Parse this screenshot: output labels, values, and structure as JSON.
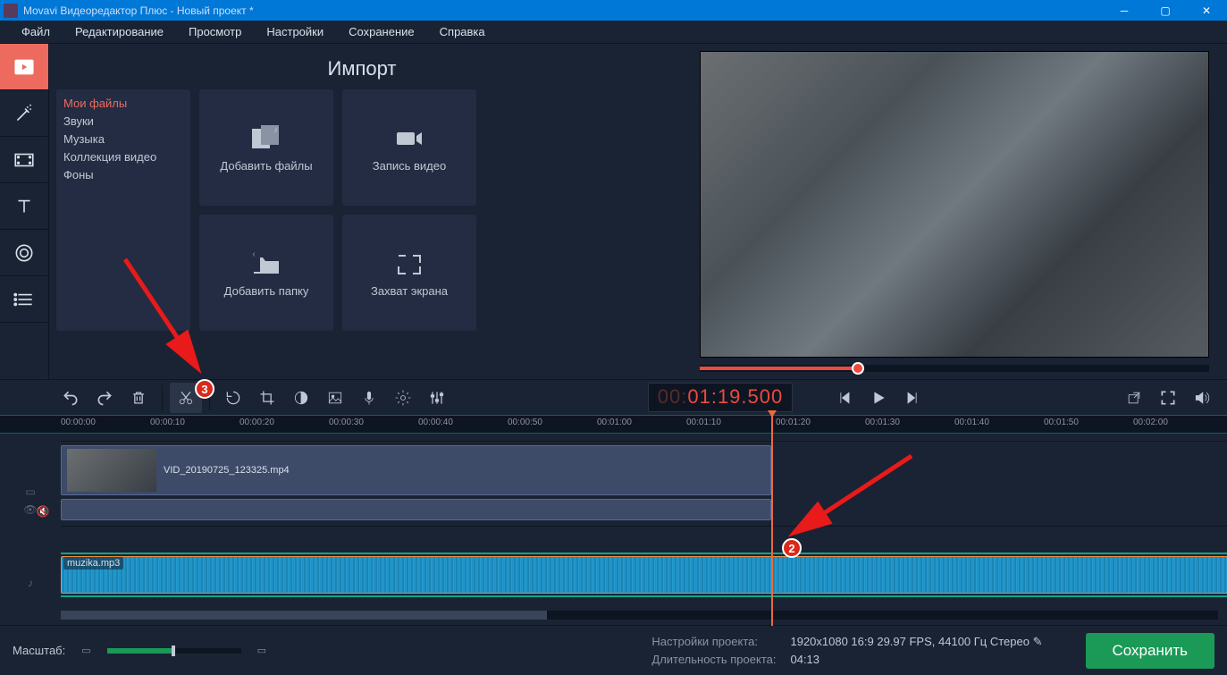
{
  "title": "Movavi Видеоредактор Плюс - Новый проект *",
  "menu": [
    "Файл",
    "Редактирование",
    "Просмотр",
    "Настройки",
    "Сохранение",
    "Справка"
  ],
  "import": {
    "heading": "Импорт",
    "categories": [
      "Мои файлы",
      "Звуки",
      "Музыка",
      "Коллекция видео",
      "Фоны"
    ],
    "active_category": 0,
    "cards": [
      "Добавить файлы",
      "Запись видео",
      "Добавить папку",
      "Захват экрана"
    ]
  },
  "timecode": {
    "dim_prefix": "00:",
    "value": "01:19.500"
  },
  "ruler_ticks": [
    "00:00:00",
    "00:00:10",
    "00:00:20",
    "00:00:30",
    "00:00:40",
    "00:00:50",
    "00:01:00",
    "00:01:10",
    "00:01:20",
    "00:01:30",
    "00:01:40",
    "00:01:50",
    "00:02:00"
  ],
  "clips": {
    "video_name": "VID_20190725_123325.mp4",
    "audio_name": "muzika.mp3"
  },
  "footer": {
    "zoom_label": "Масштаб:",
    "settings_label": "Настройки проекта:",
    "settings_value": "1920x1080 16:9 29.97 FPS, 44100 Гц Стерео",
    "duration_label": "Длительность проекта:",
    "duration_value": "04:13",
    "save": "Сохранить"
  },
  "annotations": {
    "badge2": "2",
    "badge3": "3"
  }
}
